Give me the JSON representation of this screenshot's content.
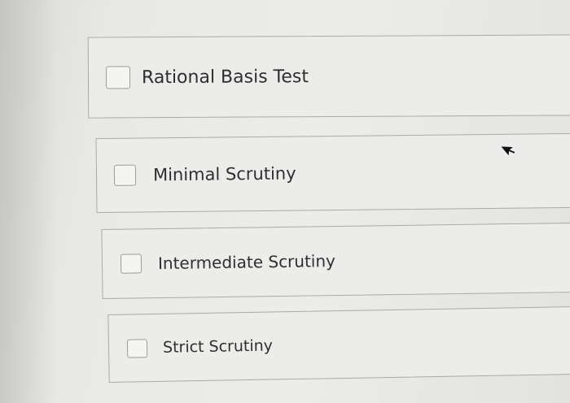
{
  "options": [
    {
      "label": "Rational Basis Test",
      "checked": false
    },
    {
      "label": "Minimal Scrutiny",
      "checked": false
    },
    {
      "label": "Intermediate Scrutiny",
      "checked": false
    },
    {
      "label": "Strict Scrutiny",
      "checked": false
    }
  ],
  "cursor": {
    "icon": "mouse-pointer-icon"
  }
}
